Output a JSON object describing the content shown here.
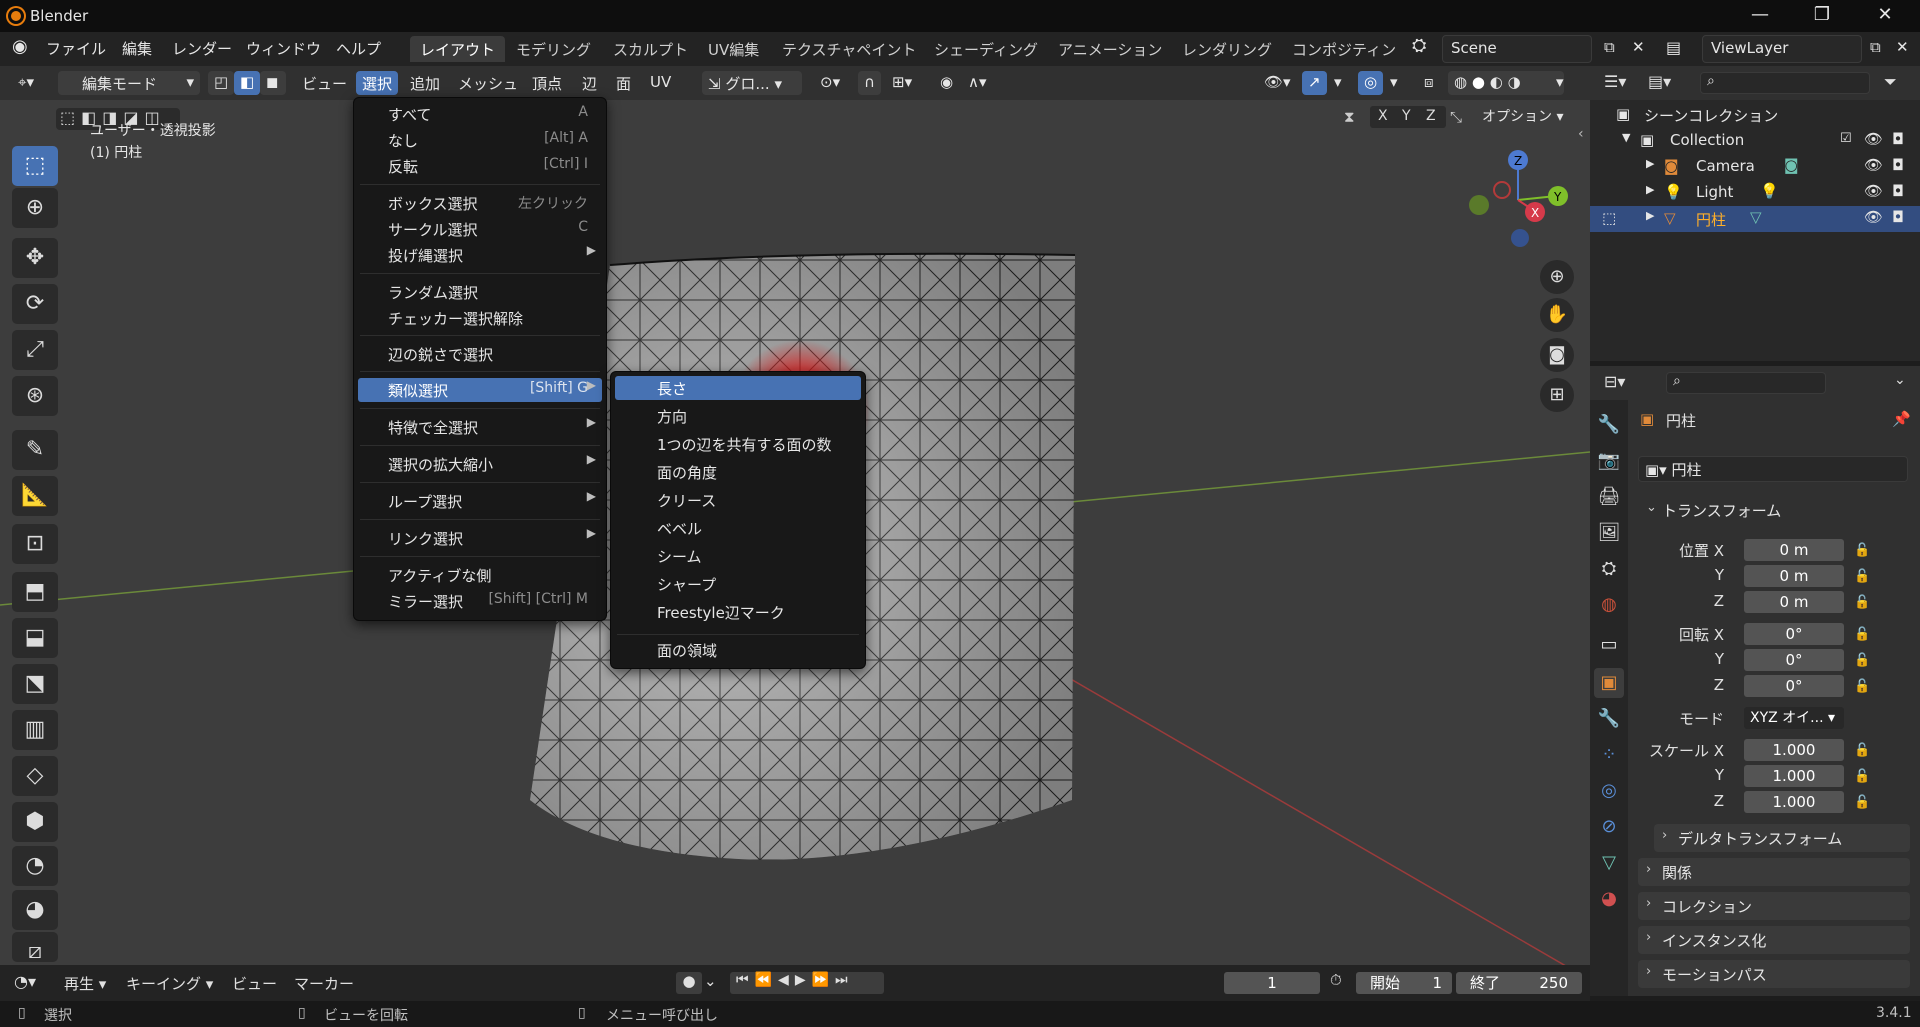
{
  "window": {
    "title": "Blender"
  },
  "top_menu": [
    "ファイル",
    "編集",
    "レンダー",
    "ウィンドウ",
    "ヘルプ"
  ],
  "workspaces": [
    {
      "label": "レイアウト",
      "active": true
    },
    {
      "label": "モデリング"
    },
    {
      "label": "スカルプト"
    },
    {
      "label": "UV編集"
    },
    {
      "label": "テクスチャペイント"
    },
    {
      "label": "シェーディング"
    },
    {
      "label": "アニメーション"
    },
    {
      "label": "レンダリング"
    },
    {
      "label": "コンポジティン"
    }
  ],
  "scene": {
    "name": "Scene",
    "view_layer": "ViewLayer"
  },
  "viewport_header": {
    "mode": "編集モード",
    "menus": [
      "ビュー",
      "選択",
      "追加",
      "メッシュ",
      "頂点",
      "辺",
      "面",
      "UV"
    ],
    "transform_orientation": "グロ...",
    "axes": [
      "X",
      "Y",
      "Z"
    ],
    "options": "オプション"
  },
  "viewport": {
    "view_name": "ユーザー・透視投影",
    "object_label": "(1) 円柱",
    "gizmo": {
      "z": "Z",
      "y": "Y",
      "x": "X"
    }
  },
  "select_menu": {
    "items": [
      {
        "label": "すべて",
        "shortcut": "A"
      },
      {
        "label": "なし",
        "shortcut": "[Alt] A"
      },
      {
        "label": "反転",
        "shortcut": "[Ctrl] I"
      },
      {
        "label": "ボックス選択",
        "shortcut": "左クリック"
      },
      {
        "label": "サークル選択",
        "shortcut": "C"
      },
      {
        "label": "投げ縄選択",
        "shortcut": ""
      },
      {
        "label": "ランダム選択",
        "shortcut": ""
      },
      {
        "label": "チェッカー選択解除",
        "shortcut": ""
      },
      {
        "label": "辺の鋭さで選択",
        "shortcut": ""
      },
      {
        "label": "類似選択",
        "shortcut": "[Shift] G"
      },
      {
        "label": "特徴で全選択",
        "shortcut": ""
      },
      {
        "label": "選択の拡大縮小",
        "shortcut": ""
      },
      {
        "label": "ループ選択",
        "shortcut": ""
      },
      {
        "label": "リンク選択",
        "shortcut": ""
      },
      {
        "label": "アクティブな側",
        "shortcut": ""
      },
      {
        "label": "ミラー選択",
        "shortcut": "[Shift] [Ctrl] M"
      }
    ]
  },
  "similar_submenu": {
    "items": [
      "長さ",
      "方向",
      "1つの辺を共有する面の数",
      "面の角度",
      "クリース",
      "ベベル",
      "シーム",
      "シャープ",
      "Freestyle辺マーク",
      "面の領域"
    ]
  },
  "outliner": {
    "root": "シーンコレクション",
    "collection": "Collection",
    "objects": [
      "Camera",
      "Light",
      "円柱"
    ]
  },
  "properties": {
    "object_name": "円柱",
    "data_name": "円柱",
    "transform_header": "トランスフォーム",
    "location_label": "位置 X",
    "location": [
      "0 m",
      "0 m",
      "0 m"
    ],
    "rotation_label": "回転 X",
    "rotation": [
      "0°",
      "0°",
      "0°"
    ],
    "mode_label": "モード",
    "mode_value": "XYZ オイ...",
    "scale_label": "スケール X",
    "scale": [
      "1.000",
      "1.000",
      "1.000"
    ],
    "y": "Y",
    "z": "Z",
    "panels": [
      "デルタトランスフォーム",
      "関係",
      "コレクション",
      "インスタンス化",
      "モーションパス"
    ]
  },
  "timeline": {
    "menus": [
      "再生",
      "キーイング",
      "ビュー",
      "マーカー"
    ],
    "current_frame": "1",
    "start_label": "開始",
    "start": "1",
    "end_label": "終了",
    "end": "250"
  },
  "statusbar": {
    "items": [
      "選択",
      "ビューを回転",
      "メニュー呼び出し"
    ],
    "version": "3.4.1"
  },
  "colors": {
    "accent": "#4772b3",
    "background": "#3d3d3d",
    "menu": "#181818",
    "cursor_highlight": "#d41414"
  }
}
